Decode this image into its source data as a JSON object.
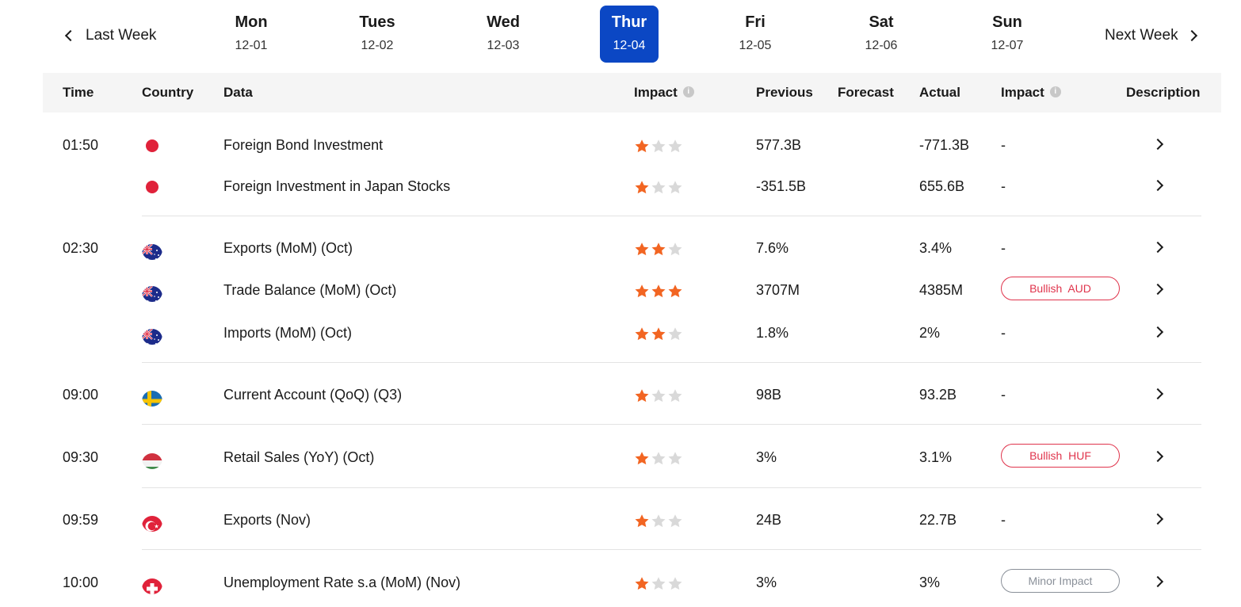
{
  "week_nav": {
    "prev_label": "Last Week",
    "next_label": "Next Week",
    "days": [
      {
        "name": "Mon",
        "date": "12-01",
        "active": false
      },
      {
        "name": "Tues",
        "date": "12-02",
        "active": false
      },
      {
        "name": "Wed",
        "date": "12-03",
        "active": false
      },
      {
        "name": "Thur",
        "date": "12-04",
        "active": true
      },
      {
        "name": "Fri",
        "date": "12-05",
        "active": false
      },
      {
        "name": "Sat",
        "date": "12-06",
        "active": false
      },
      {
        "name": "Sun",
        "date": "12-07",
        "active": false
      }
    ]
  },
  "table": {
    "headers": {
      "time": "Time",
      "country": "Country",
      "data": "Data",
      "impact": "Impact",
      "previous": "Previous",
      "forecast": "Forecast",
      "actual": "Actual",
      "impact2": "Impact",
      "description": "Description"
    },
    "rows": [
      {
        "time": "01:50",
        "country_icon": "japan-flag-icon",
        "data": "Foreign Bond Investment",
        "stars": 1,
        "previous": "577.3B",
        "forecast": "",
        "actual": "-771.3B",
        "impact": "-",
        "badge_type": "none"
      },
      {
        "time": "",
        "country_icon": "japan-flag-icon",
        "data": "Foreign Investment in Japan Stocks",
        "stars": 1,
        "previous": "-351.5B",
        "forecast": "",
        "actual": "655.6B",
        "impact": "-",
        "badge_type": "none"
      },
      {
        "time": "02:30",
        "country_icon": "australia-flag-icon",
        "data": "Exports (MoM) (Oct)",
        "stars": 2,
        "previous": "7.6%",
        "forecast": "",
        "actual": "3.4%",
        "impact": "-",
        "badge_type": "none"
      },
      {
        "time": "",
        "country_icon": "australia-flag-icon",
        "data": "Trade Balance (MoM) (Oct)",
        "stars": 3,
        "previous": "3707M",
        "forecast": "",
        "actual": "4385M",
        "impact": "Bullish  AUD",
        "badge_type": "bullish"
      },
      {
        "time": "",
        "country_icon": "australia-flag-icon",
        "data": "Imports (MoM) (Oct)",
        "stars": 2,
        "previous": "1.8%",
        "forecast": "",
        "actual": "2%",
        "impact": "-",
        "badge_type": "none"
      },
      {
        "time": "09:00",
        "country_icon": "sweden-flag-icon",
        "data": "Current Account (QoQ) (Q3)",
        "stars": 1,
        "previous": "98B",
        "forecast": "",
        "actual": "93.2B",
        "impact": "-",
        "badge_type": "none"
      },
      {
        "time": "09:30",
        "country_icon": "hungary-flag-icon",
        "data": "Retail Sales (YoY) (Oct)",
        "stars": 1,
        "previous": "3%",
        "forecast": "",
        "actual": "3.1%",
        "impact": "Bullish  HUF",
        "badge_type": "bullish"
      },
      {
        "time": "09:59",
        "country_icon": "turkey-flag-icon",
        "data": "Exports (Nov)",
        "stars": 1,
        "previous": "24B",
        "forecast": "",
        "actual": "22.7B",
        "impact": "-",
        "badge_type": "none"
      },
      {
        "time": "10:00",
        "country_icon": "switzerland-flag-icon",
        "data": "Unemployment Rate s.a (MoM) (Nov)",
        "stars": 1,
        "previous": "3%",
        "forecast": "",
        "actual": "3%",
        "impact": "Minor Impact",
        "badge_type": "minor"
      }
    ]
  },
  "colors": {
    "accent": "#0b47c4",
    "star_on": "#f26522",
    "star_off": "#d9d9d9",
    "bullish": "#e0344c",
    "minor": "#8a9099"
  }
}
